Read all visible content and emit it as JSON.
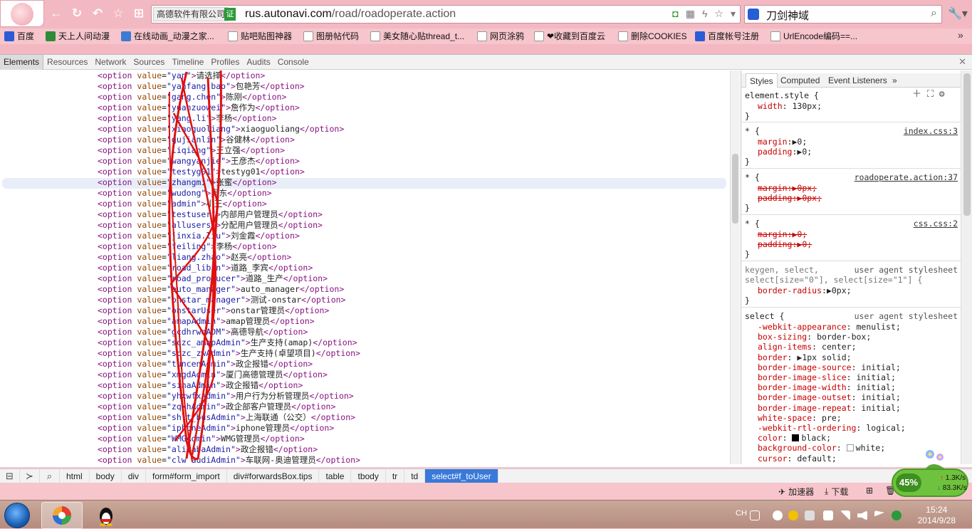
{
  "browser": {
    "address_badge": "高德软件有限公司",
    "ev_icon_label": "证",
    "url_host": "rus.autonavi.com",
    "url_path": "/road/roadoperate.action",
    "search_engine_icon": "paw-icon",
    "search_text": "刀剑神域"
  },
  "bookmarks": [
    {
      "label": "百度",
      "color": "#2b5bd7"
    },
    {
      "label": "天上人间动漫",
      "color": "#2e8b3a"
    },
    {
      "label": "在线动画_动漫之家...",
      "color": "#3b7bd5"
    },
    {
      "label": "贴吧贴图神器",
      "color": "#ffffff"
    },
    {
      "label": "图册帖代码",
      "color": "#ffffff"
    },
    {
      "label": "美女随心贴thread_t...",
      "color": "#ffffff"
    },
    {
      "label": "网页涂鸦",
      "color": "#ffffff"
    },
    {
      "label": "❤收藏到百度云",
      "color": "#ffffff"
    },
    {
      "label": "删除COOKIES",
      "color": "#ffffff"
    },
    {
      "label": "百度帐号注册",
      "color": "#2b5bd7"
    },
    {
      "label": "UrlEncode编码==...",
      "color": "#ffffff"
    }
  ],
  "devtools": {
    "tabs": [
      "Elements",
      "Resources",
      "Network",
      "Sources",
      "Timeline",
      "Profiles",
      "Audits",
      "Console"
    ],
    "active_tab": "Elements",
    "dom_lines": [
      {
        "v": "yan",
        "t": "请选择"
      },
      {
        "v": "yanfang.bao",
        "t": "包艳芳"
      },
      {
        "v": "gang.chen",
        "t": "陈刚"
      },
      {
        "v": "yuanzuowei",
        "t": "詹作为"
      },
      {
        "v": "yang.li",
        "t": "李杨"
      },
      {
        "v": "xiaoguoliang",
        "t": "xiaoguoliang"
      },
      {
        "v": "gujianlin",
        "t": "谷健林"
      },
      {
        "v": "liqiang",
        "t": "王立强"
      },
      {
        "v": "wangyanjie",
        "t": "王彦杰"
      },
      {
        "v": "testyg01",
        "t": "testyg01"
      },
      {
        "v": "zhangmi",
        "t": "张蜜"
      },
      {
        "v": "wudong",
        "t": "吴东"
      },
      {
        "v": "admin",
        "t": "小王"
      },
      {
        "v": "testuser",
        "t": "内部用户管理员"
      },
      {
        "v": "allusers",
        "t": "分配用户管理员"
      },
      {
        "v": "jinxia.liu",
        "t": "刘金霞"
      },
      {
        "v": "feiling",
        "t": "李杨"
      },
      {
        "v": "liang.zhao",
        "t": "赵亮"
      },
      {
        "v": "road_libin",
        "t": "道路_李宾"
      },
      {
        "v": "road_producer",
        "t": "道路_生产"
      },
      {
        "v": "auto_manager",
        "t": "auto_manager"
      },
      {
        "v": "onstar_manager",
        "t": "测试-onstar"
      },
      {
        "v": "onstarUser",
        "t": "onstar管理员"
      },
      {
        "v": "amapAdmin",
        "t": "amap管理员"
      },
      {
        "v": "gcdhrwqADM",
        "t": "高德导航"
      },
      {
        "v": "sczc_amapAdmin",
        "t": "生产支持(amap)"
      },
      {
        "v": "sczc_zwAdmin",
        "t": "生产支持(卓望项目)"
      },
      {
        "v": "tuncenAdmin",
        "t": "政企报错"
      },
      {
        "v": "xmgdAdmin",
        "t": "厦门高德管理员"
      },
      {
        "v": "sinaAdmin",
        "t": "政企报错"
      },
      {
        "v": "yhxwfxAdmin",
        "t": "用户行为分析管理员"
      },
      {
        "v": "zqkhAdmin",
        "t": "政企部客户管理员"
      },
      {
        "v": "shlt_busAdmin",
        "t": "上海联通（公交）"
      },
      {
        "v": "iphoneAdmin",
        "t": "iphone管理员"
      },
      {
        "v": "WMGAdmin",
        "t": "WMG管理员"
      },
      {
        "v": "alibabaAdmin",
        "t": "政企报错"
      },
      {
        "v": "clw_audiAdmin",
        "t": "车联网-奥迪管理员"
      }
    ],
    "styles_tabs": [
      "Styles",
      "Computed",
      "Event Listeners",
      "»"
    ],
    "styles": {
      "element_style_selector": "element.style {",
      "element_width_prop": "width",
      "element_width_val": "130px;",
      "rule1_src": "index.css:3",
      "rule2_src": "roadoperate.action:37",
      "rule3_src": "css.css:2",
      "star_selector": "* {",
      "margin_prop": "margin",
      "padding_prop": "padding",
      "val0": "0;",
      "val0px": "0px;",
      "ua_label": "user agent stylesheet",
      "keygen_sel1": "keygen, select,",
      "keygen_sel2": "select[size=\"0\"], select[size=\"1\"] {",
      "border_radius": "border-radius",
      "select_sel": "select {",
      "select_props": [
        [
          "-webkit-appearance",
          "menulist;"
        ],
        [
          "box-sizing",
          "border-box;"
        ],
        [
          "align-items",
          "center;"
        ],
        [
          "border",
          "1px solid;"
        ],
        [
          "border-image-source",
          "initial;"
        ],
        [
          "border-image-slice",
          "initial;"
        ],
        [
          "border-image-width",
          "initial;"
        ],
        [
          "border-image-outset",
          "initial;"
        ],
        [
          "border-image-repeat",
          "initial;"
        ],
        [
          "white-space",
          "pre;"
        ],
        [
          "-webkit-rtl-ordering",
          "logical;"
        ],
        [
          "color",
          "black;"
        ],
        [
          "background-color",
          "white;"
        ],
        [
          "cursor",
          "default;"
        ]
      ]
    },
    "breadcrumbs": [
      "html",
      "body",
      "div",
      "form#form_import",
      "div#forwardsBox.tips",
      "table",
      "tbody",
      "tr",
      "td",
      "select#f_toUser"
    ],
    "active_crumb": "select#f_toUser"
  },
  "status": {
    "accelerator": "加速器",
    "download": "下载",
    "net_percent": "45%",
    "net_up": "1.3K/s",
    "net_down": "83.3K/s"
  },
  "taskbar": {
    "lang": "CH",
    "time": "15:24",
    "date": "2014/9/28"
  },
  "colors": {
    "chrome_pink": "#f3b9c2",
    "active_crumb": "#3879d9",
    "tag_purple": "#881280",
    "attr_brown": "#994500",
    "value_blue": "#1a1aa6",
    "scribble_red": "#e01010"
  }
}
